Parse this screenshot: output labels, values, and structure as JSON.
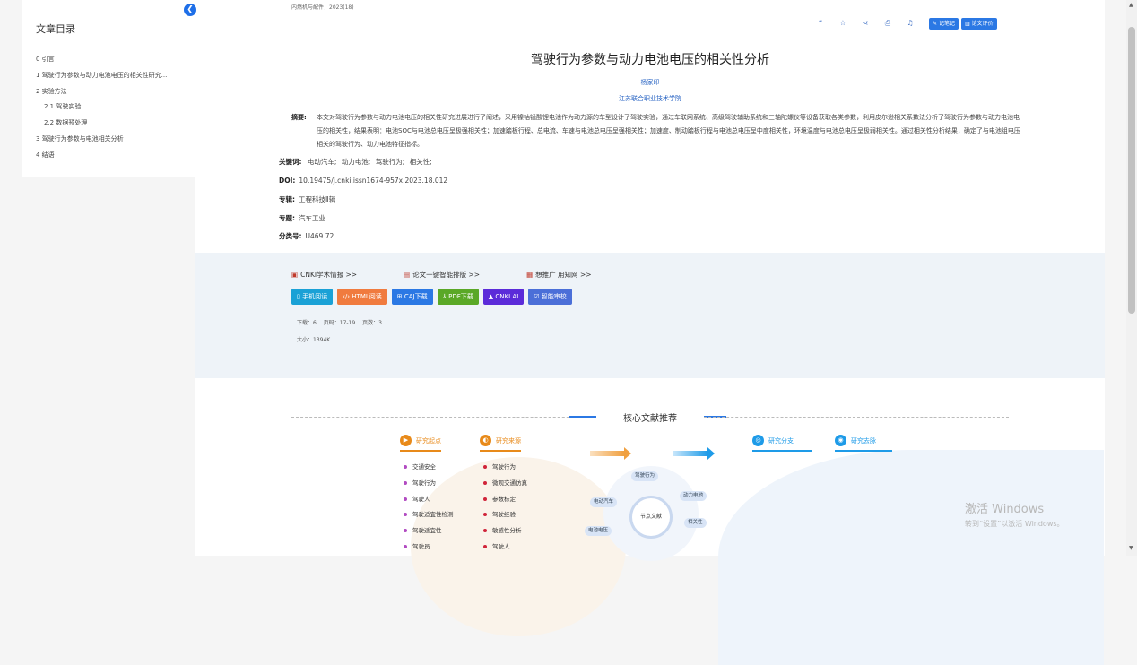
{
  "sidebar": {
    "title": "文章目录",
    "collapse_icon": "chevron-left-icon",
    "items": [
      {
        "label": "0 引言",
        "level": 1
      },
      {
        "label": "1 驾驶行为参数与动力电池电压的相关性研究...",
        "level": 1
      },
      {
        "label": "2 实验方法",
        "level": 1
      },
      {
        "label": "2.1 驾驶实验",
        "level": 2
      },
      {
        "label": "2.2 数据预处理",
        "level": 2
      },
      {
        "label": "3 驾驶行为参数与电池相关分析",
        "level": 1
      },
      {
        "label": "4 结语",
        "level": 1
      }
    ]
  },
  "article": {
    "source": "内燃机与配件，2023(18)",
    "toolbar": {
      "icons": [
        "quote-icon",
        "star-icon",
        "share-icon",
        "print-icon",
        "bell-icon"
      ],
      "note_button": "记笔记",
      "review_button": "论文评价"
    },
    "title": "驾驶行为参数与动力电池电压的相关性分析",
    "author": "杨家印",
    "organization": "江苏联合职业技术学院",
    "abstract_label": "摘要:",
    "abstract_text": "本文对驾驶行为参数与动力电池电压的相关性研究进展进行了阐述，采用镍钴锰酸锂电池作为动力源的车型设计了驾驶实验，通过车联网系统、高级驾驶辅助系统和三轴陀螺仪等设备获取各类参数，利用皮尔逊相关系数法分析了驾驶行为参数与动力电池电压的相关性，结果表明：电池SOC与电池总电压呈极强相关性；加速踏板行程、总电流、车速与电池总电压呈强相关性；加速度、制动踏板行程与电池总电压呈中度相关性，环境温度与电池总电压呈极弱相关性。通过相关性分析结果，确定了与电池组电压相关的驾驶行为、动力电池特征指标。",
    "keywords_label": "关键词:",
    "keywords": [
      "电动汽车;",
      "动力电池;",
      "驾驶行为;",
      "相关性;"
    ],
    "doi_label": "DOI:",
    "doi": "10.19475/j.cnki.issn1674-957x.2023.18.012",
    "series_label": "专辑:",
    "series": "工程科技Ⅱ辑",
    "topic_label": "专题:",
    "topic": "汽车工业",
    "class_label": "分类号:",
    "class_no": "U469.72"
  },
  "download": {
    "links": [
      {
        "label": "CNKI学术情报 >>",
        "icon": "book-icon"
      },
      {
        "label": "论文一键智能排版 >>",
        "icon": "document-icon"
      },
      {
        "label": "想推广 用知网 >>",
        "icon": "megaphone-icon"
      }
    ],
    "buttons": [
      {
        "label": "手机阅读",
        "icon": "phone-icon",
        "color": "#1aa1d6"
      },
      {
        "label": "HTML阅读",
        "icon": "code-icon",
        "color": "#f07b3f"
      },
      {
        "label": "CAJ下载",
        "icon": "book-open-icon",
        "color": "#2b78e4"
      },
      {
        "label": "PDF下载",
        "icon": "pdf-icon",
        "color": "#5aa827"
      },
      {
        "label": "CNKI AI",
        "icon": "ai-icon",
        "color": "#5b2bd9"
      },
      {
        "label": "智能审校",
        "icon": "check-doc-icon",
        "color": "#4b6fd8"
      }
    ],
    "stats": {
      "downloads": "下载：6",
      "pages": "页码：17-19",
      "page_count": "页数：3"
    },
    "size": "大小：1394K"
  },
  "recommend": {
    "title": "核心文献推荐",
    "columns": [
      {
        "title": "研究起点",
        "color": "#e88a1a",
        "bullet": "#b24bc2",
        "items": [
          "交通安全",
          "驾驶行为",
          "驾驶人",
          "驾驶适宜性检测",
          "驾驶适宜性",
          "驾驶员"
        ]
      },
      {
        "title": "研究来源",
        "color": "#e88a1a",
        "bullet": "#d0243a",
        "items": [
          "驾驶行为",
          "微观交通仿真",
          "参数标定",
          "驾驶经验",
          "敏感性分析",
          "驾驶人"
        ]
      },
      {
        "title": "研究分支",
        "color": "#1e9be8",
        "bullet": "",
        "items": []
      },
      {
        "title": "研究去脉",
        "color": "#1e9be8",
        "bullet": "",
        "items": []
      }
    ],
    "node_center": "节点文献",
    "chips": [
      "驾驶行为",
      "电动汽车",
      "动力电池",
      "相关性",
      "电池电压"
    ]
  },
  "watermark": {
    "line1": "激活 Windows",
    "line2": "转到“设置”以激活 Windows。"
  }
}
